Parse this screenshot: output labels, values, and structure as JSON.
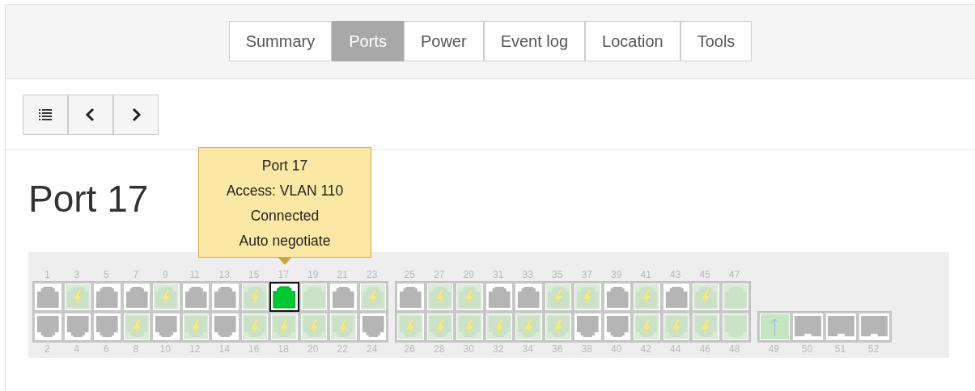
{
  "tabs": [
    {
      "label": "Summary",
      "selected": false
    },
    {
      "label": "Ports",
      "selected": true
    },
    {
      "label": "Power",
      "selected": false
    },
    {
      "label": "Event log",
      "selected": false
    },
    {
      "label": "Location",
      "selected": false
    },
    {
      "label": "Tools",
      "selected": false
    }
  ],
  "toolbar": [
    {
      "kind": "list"
    },
    {
      "kind": "prev"
    },
    {
      "kind": "next"
    }
  ],
  "heading": "Port 17",
  "tooltip": {
    "lines": [
      "Port 17",
      "Access: VLAN 110",
      "Connected",
      "Auto negotiate"
    ]
  },
  "port_groups": [
    {
      "kind": "rj45",
      "top": [
        {
          "number": "1",
          "connected": false,
          "poe": false,
          "selected": false
        },
        {
          "number": "3",
          "connected": true,
          "poe": true,
          "selected": false
        },
        {
          "number": "5",
          "connected": false,
          "poe": false,
          "selected": false
        },
        {
          "number": "7",
          "connected": false,
          "poe": false,
          "selected": false
        },
        {
          "number": "9",
          "connected": true,
          "poe": true,
          "selected": false
        },
        {
          "number": "11",
          "connected": false,
          "poe": false,
          "selected": false
        },
        {
          "number": "13",
          "connected": false,
          "poe": false,
          "selected": false
        },
        {
          "number": "15",
          "connected": true,
          "poe": true,
          "selected": false
        },
        {
          "number": "17",
          "connected": true,
          "poe": false,
          "selected": true
        },
        {
          "number": "19",
          "connected": true,
          "poe": false,
          "selected": false
        },
        {
          "number": "21",
          "connected": false,
          "poe": false,
          "selected": false
        },
        {
          "number": "23",
          "connected": true,
          "poe": true,
          "selected": false
        }
      ],
      "bottom": [
        {
          "number": "2",
          "connected": false,
          "poe": false,
          "selected": false
        },
        {
          "number": "4",
          "connected": false,
          "poe": false,
          "selected": false
        },
        {
          "number": "6",
          "connected": false,
          "poe": false,
          "selected": false
        },
        {
          "number": "8",
          "connected": true,
          "poe": true,
          "selected": false
        },
        {
          "number": "10",
          "connected": false,
          "poe": false,
          "selected": false
        },
        {
          "number": "12",
          "connected": true,
          "poe": true,
          "selected": false
        },
        {
          "number": "14",
          "connected": false,
          "poe": false,
          "selected": false
        },
        {
          "number": "16",
          "connected": true,
          "poe": true,
          "selected": false
        },
        {
          "number": "18",
          "connected": true,
          "poe": true,
          "selected": false
        },
        {
          "number": "20",
          "connected": true,
          "poe": true,
          "selected": false
        },
        {
          "number": "22",
          "connected": true,
          "poe": true,
          "selected": false
        },
        {
          "number": "24",
          "connected": false,
          "poe": false,
          "selected": false
        }
      ]
    },
    {
      "kind": "rj45",
      "top": [
        {
          "number": "25",
          "connected": false,
          "poe": false,
          "selected": false
        },
        {
          "number": "27",
          "connected": true,
          "poe": true,
          "selected": false
        },
        {
          "number": "29",
          "connected": true,
          "poe": true,
          "selected": false
        },
        {
          "number": "31",
          "connected": false,
          "poe": false,
          "selected": false
        },
        {
          "number": "33",
          "connected": false,
          "poe": false,
          "selected": false
        },
        {
          "number": "35",
          "connected": true,
          "poe": true,
          "selected": false
        },
        {
          "number": "37",
          "connected": true,
          "poe": true,
          "selected": false
        },
        {
          "number": "39",
          "connected": false,
          "poe": false,
          "selected": false
        },
        {
          "number": "41",
          "connected": true,
          "poe": true,
          "selected": false
        },
        {
          "number": "43",
          "connected": false,
          "poe": false,
          "selected": false
        },
        {
          "number": "45",
          "connected": true,
          "poe": true,
          "selected": false
        },
        {
          "number": "47",
          "connected": true,
          "poe": false,
          "selected": false
        }
      ],
      "bottom": [
        {
          "number": "26",
          "connected": true,
          "poe": true,
          "selected": false
        },
        {
          "number": "28",
          "connected": true,
          "poe": true,
          "selected": false
        },
        {
          "number": "30",
          "connected": true,
          "poe": true,
          "selected": false
        },
        {
          "number": "32",
          "connected": true,
          "poe": true,
          "selected": false
        },
        {
          "number": "34",
          "connected": true,
          "poe": true,
          "selected": false
        },
        {
          "number": "36",
          "connected": true,
          "poe": true,
          "selected": false
        },
        {
          "number": "38",
          "connected": false,
          "poe": false,
          "selected": false
        },
        {
          "number": "40",
          "connected": false,
          "poe": false,
          "selected": false
        },
        {
          "number": "42",
          "connected": true,
          "poe": true,
          "selected": false
        },
        {
          "number": "44",
          "connected": true,
          "poe": true,
          "selected": false
        },
        {
          "number": "46",
          "connected": true,
          "poe": true,
          "selected": false
        },
        {
          "number": "48",
          "connected": true,
          "poe": false,
          "selected": false
        }
      ]
    },
    {
      "kind": "uplink",
      "bottom": [
        {
          "number": "49",
          "connected": true,
          "poe": false,
          "selected": false
        },
        {
          "number": "50",
          "connected": false,
          "poe": false,
          "selected": false
        },
        {
          "number": "51",
          "connected": false,
          "poe": false,
          "selected": false
        },
        {
          "number": "52",
          "connected": false,
          "poe": false,
          "selected": false
        }
      ]
    }
  ]
}
